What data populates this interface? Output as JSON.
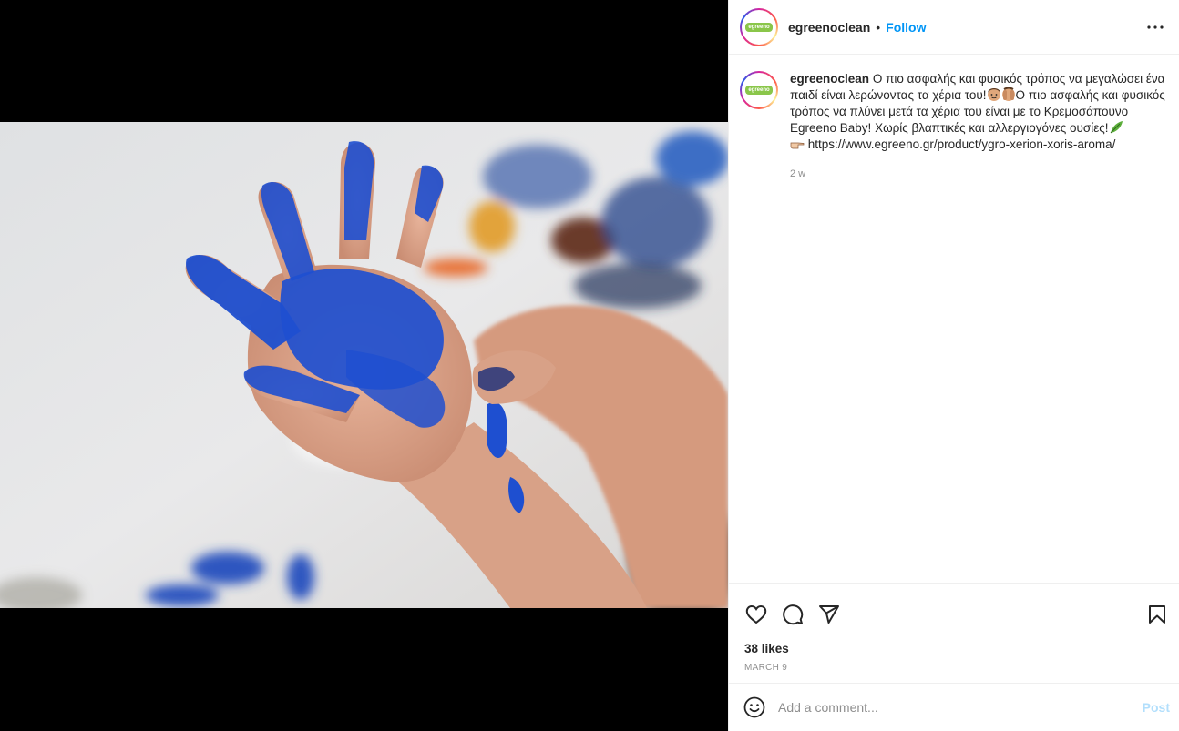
{
  "post": {
    "username": "egreenoclean",
    "avatar_logo": "egreeno",
    "follow_label": "Follow",
    "separator": "•",
    "caption": {
      "text_part1": "Ο πιο ασφαλής και φυσικός τρόπος να μεγαλώσει ένα παιδί είναι λερώνοντας τα χέρια του!",
      "text_part2": "Ο πιο ασφαλής και φυσικός τρόπος να πλύνει μετά τα χέρια του είναι με το Κρεμοσάπουνο Egreeno Baby! Χωρίς βλαπτικές και αλλεργιογόνες ουσίες!",
      "link": "https://www.egreeno.gr/product/ygro-xerion-xoris-aroma/",
      "time": "2 w",
      "emojis": [
        "child-face-emoji",
        "hands-over-face-emoji",
        "leaf-emoji",
        "pointing-hand-emoji"
      ]
    },
    "likes": "38 likes",
    "date": "MARCH 9",
    "comment": {
      "placeholder": "Add a comment...",
      "post_label": "Post"
    },
    "icons": [
      "more-options-icon",
      "heart-icon",
      "comment-icon",
      "share-icon",
      "bookmark-icon",
      "emoji-icon"
    ],
    "colors": {
      "follow": "#0095f6",
      "post_disabled": "#b2dffc",
      "logo_green": "#8ac64a",
      "paint_blue": "#1e4fd0"
    }
  }
}
